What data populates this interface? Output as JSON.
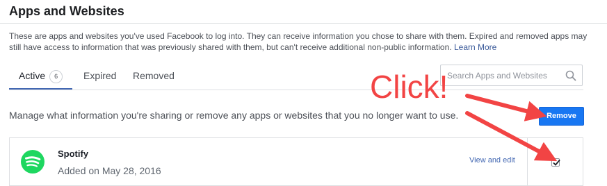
{
  "header": {
    "title": "Apps and Websites",
    "description": "These are apps and websites you've used Facebook to log into. They can receive information you chose to share with them. Expired and removed apps may still have access to information that was previously shared with them, but can't receive additional non-public information.",
    "learn_more": "Learn More"
  },
  "tabs": [
    {
      "label": "Active",
      "count": "6",
      "active": true
    },
    {
      "label": "Expired"
    },
    {
      "label": "Removed"
    }
  ],
  "search": {
    "placeholder": "Search Apps and Websites",
    "icon": "search-icon"
  },
  "manage": {
    "text": "Manage what information you're sharing or remove any apps or websites that you no longer want to use.",
    "remove_label": "Remove"
  },
  "apps": [
    {
      "name": "Spotify",
      "added": "Added on May 28, 2016",
      "action": "View and edit",
      "checked": true,
      "icon": "spotify-logo-icon"
    }
  ],
  "annotation": {
    "text": "Click!",
    "color": "#f24444"
  },
  "colors": {
    "accent": "#4267b2",
    "button": "#1877f2",
    "spotify": "#1ed760"
  }
}
